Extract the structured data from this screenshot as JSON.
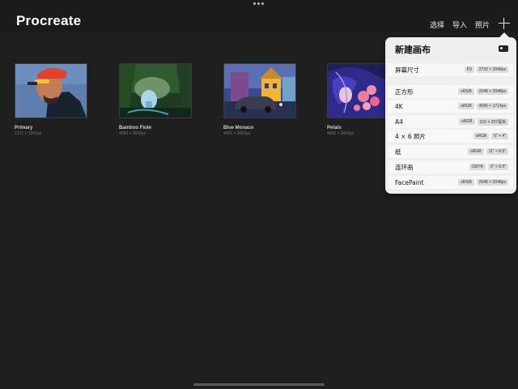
{
  "app": {
    "title": "Procreate"
  },
  "toolbar": {
    "select_label": "选择",
    "import_label": "导入",
    "photos_label": "照片"
  },
  "gallery": [
    {
      "title": "Primary",
      "size": "2121 × 1591px"
    },
    {
      "title": "Bamboo Flute",
      "size": "4000 × 3000px"
    },
    {
      "title": "Blue Monaco",
      "size": "4000 × 3000px"
    },
    {
      "title": "Petals",
      "size": "4000 × 3000px"
    }
  ],
  "new_canvas": {
    "title": "新建画布",
    "screen": {
      "name": "屏幕尺寸",
      "profile": "P3",
      "size": "2732 × 2048px"
    },
    "presets": [
      {
        "name": "正方形",
        "profile": "sRGB",
        "size": "2048 × 2048px"
      },
      {
        "name": "4K",
        "profile": "sRGB",
        "size": "4096 × 1714px"
      },
      {
        "name": "A4",
        "profile": "sRGB",
        "size": "210 × 297毫米"
      },
      {
        "name": "4 × 6 照片",
        "profile": "sRGB",
        "size": "6\" × 4\""
      },
      {
        "name": "纸",
        "profile": "sRGB",
        "size": "11\" × 8.5\""
      },
      {
        "name": "连环画",
        "profile": "CMYK",
        "size": "6\" × 9.5\""
      },
      {
        "name": "FacePaint",
        "profile": "sRGB",
        "size": "2048 × 2048px"
      }
    ]
  }
}
